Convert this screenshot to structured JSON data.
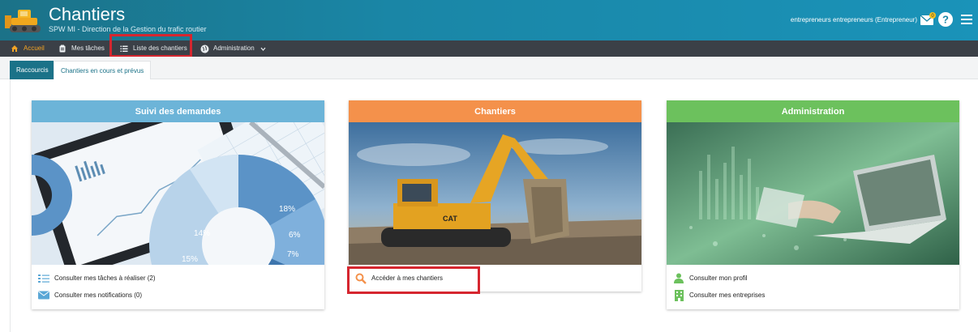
{
  "header": {
    "title": "Chantiers",
    "subtitle": "SPW MI - Direction de la Gestion du trafic routier",
    "user": "entrepreneurs entrepreneurs (Entrepreneur)",
    "mail_badge": "0",
    "colors": {
      "header": "#1a86a6",
      "navbar": "#3b4047",
      "accent": "#f3a425",
      "highlight": "#d6262f"
    }
  },
  "nav": {
    "home": "Accueil",
    "tasks": "Mes tâches",
    "list": "Liste des chantiers",
    "admin": "Administration"
  },
  "tabs": {
    "shortcuts": "Raccourcis",
    "current": "Chantiers en cours et prévus"
  },
  "cards": {
    "suivi": {
      "title": "Suivi des demandes",
      "links": [
        "Consulter mes tâches à réaliser (2)",
        "Consulter mes notifications (0)"
      ],
      "chart_labels": [
        "14%",
        "15%",
        "18%",
        "6%",
        "7%"
      ]
    },
    "chantiers": {
      "title": "Chantiers",
      "links": [
        "Accéder à mes chantiers"
      ]
    },
    "administration": {
      "title": "Administration",
      "links": [
        "Consulter mon profil",
        "Consulter mes entreprises"
      ]
    }
  },
  "icons": {
    "logo": "bulldozer-logo-icon",
    "mail": "mail-icon",
    "help": "help-icon",
    "menu": "hamburger-icon",
    "home": "home-icon",
    "tasks": "clipboard-icon",
    "list": "list-icon",
    "admin": "globe-shield-icon",
    "tasks_link": "checklist-icon",
    "notifications_link": "envelope-icon",
    "search": "search-icon",
    "profile": "user-icon",
    "companies": "building-icon"
  }
}
